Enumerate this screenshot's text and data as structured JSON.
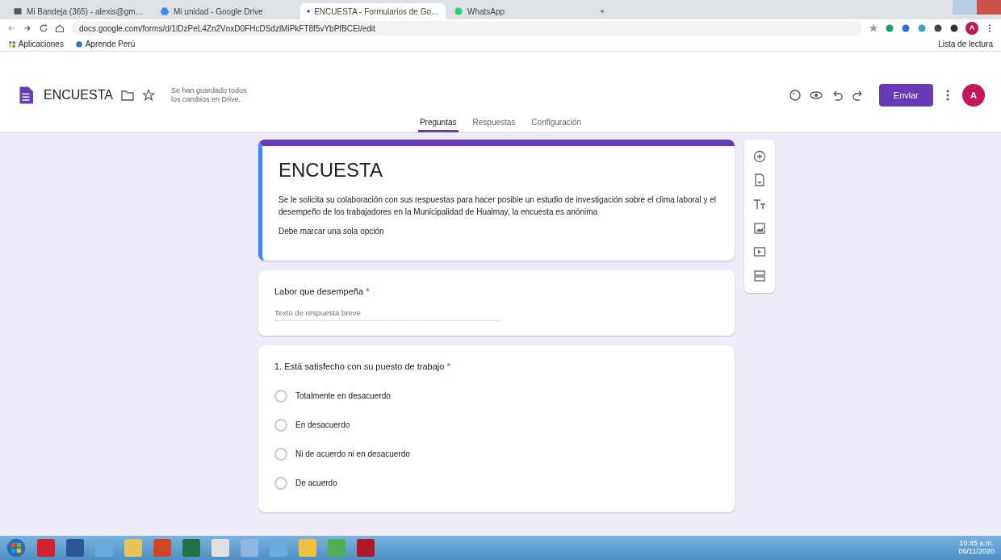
{
  "browser": {
    "tabs": [
      {
        "title": "Mi Bandeja (365) - alexis@gm…",
        "selected": false
      },
      {
        "title": "Mi unidad - Google Drive",
        "selected": false
      },
      {
        "title": "ENCUESTA - Formularios de Go…",
        "selected": true
      },
      {
        "title": "WhatsApp",
        "selected": false
      }
    ],
    "address": "docs.google.com/forms/d/1lDzPeL4Zn2VnxD0FHcDSdzlMiPkFT8f5vYbPfBCEl/edit",
    "bookmarks": [
      "Aplicaciones",
      "Aprende Perú"
    ],
    "reading_list": "Lista de lectura",
    "profile_letter": "A"
  },
  "forms_header": {
    "title": "ENCUESTA",
    "save_status": "Se han guardado todos los cambios en Drive.",
    "send_button": "Enviar",
    "avatar_letter": "A",
    "tabs": [
      {
        "label": "Preguntas",
        "selected": true
      },
      {
        "label": "Respuestas",
        "selected": false
      },
      {
        "label": "Configuración",
        "selected": false
      }
    ]
  },
  "form": {
    "title": "ENCUESTA",
    "description": "Se le solicita su colaboración con sus respuestas para hacer posible un estudio de investigación sobre el clima laboral y el desempeño de los trabajadores en la Municipalidad de Hualmay, la encuesta es anónima",
    "note": "Debe marcar una sola opción",
    "questions": [
      {
        "kind": "short",
        "title": "Labor que desempeña",
        "required_mark": "*",
        "placeholder": "Texto de respuesta breve"
      },
      {
        "kind": "radio",
        "title": "1. Está satisfecho con su puesto de trabajo",
        "required_mark": "*",
        "options": [
          {
            "label": "Totalmente en desacuerdo",
            "selected": false
          },
          {
            "label": "En desacuerdo",
            "selected": false
          },
          {
            "label": "Ni de acuerdo ni en desacuerdo",
            "selected": false
          },
          {
            "label": "De acuerdo",
            "selected": false
          }
        ]
      }
    ]
  },
  "taskbar": {
    "time": "10:45 a.m.",
    "date": "06/11/2020"
  }
}
